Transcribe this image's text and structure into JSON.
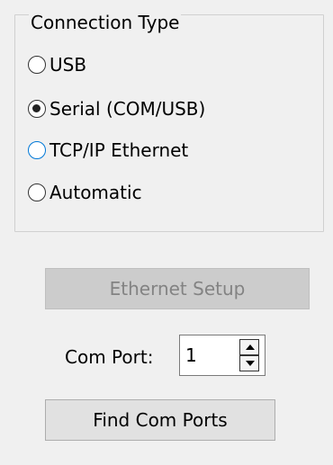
{
  "connection_group": {
    "title": "Connection Type",
    "options": [
      {
        "label": "USB",
        "selected": false,
        "focused": false
      },
      {
        "label": "Serial (COM/USB)",
        "selected": true,
        "focused": false
      },
      {
        "label": "TCP/IP Ethernet",
        "selected": false,
        "focused": true
      },
      {
        "label": "Automatic",
        "selected": false,
        "focused": false
      }
    ]
  },
  "ethernet_setup": {
    "label": "Ethernet Setup",
    "enabled": false
  },
  "com_port": {
    "label": "Com Port:",
    "value": "1"
  },
  "find_com_ports": {
    "label": "Find Com Ports"
  },
  "colors": {
    "background": "#f0f0f0",
    "focus_blue": "#0078d7",
    "disabled_text": "#838383"
  }
}
